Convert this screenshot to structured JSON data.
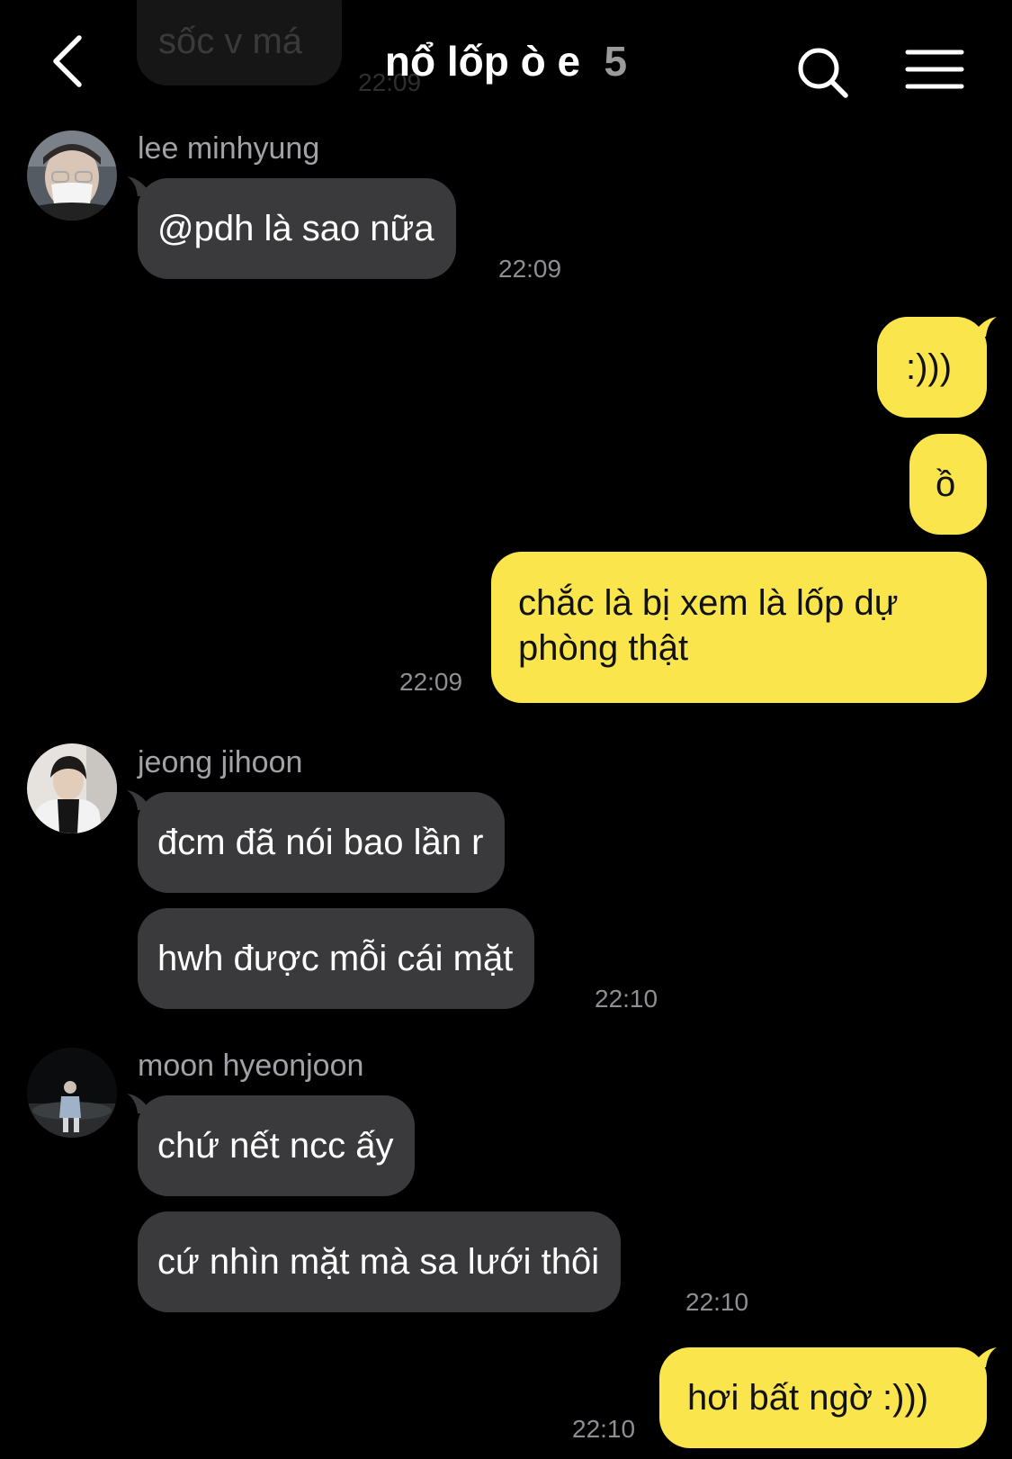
{
  "header": {
    "title": "nổ lốp ò e",
    "member_count": "5",
    "back_icon": "chevron-left-icon",
    "search_icon": "search-icon",
    "menu_icon": "hamburger-menu-icon"
  },
  "faded_prev": {
    "text": "sốc v má",
    "time": "22:09"
  },
  "messages": [
    {
      "sender": "lee minhyung",
      "avatar": "avatar-lee-minhyung",
      "bubbles": [
        "@pdh là sao nữa"
      ],
      "time": "22:09"
    },
    {
      "own": true,
      "bubbles": [
        ":)))",
        "ồ",
        "chắc là bị xem là lốp dự\nphòng thật"
      ],
      "time": "22:09"
    },
    {
      "sender": "jeong jihoon",
      "avatar": "avatar-jeong-jihoon",
      "bubbles": [
        "đcm đã nói bao lần r",
        "hwh được mỗi cái mặt"
      ],
      "time": "22:10"
    },
    {
      "sender": "moon hyeonjoon",
      "avatar": "avatar-moon-hyeonjoon",
      "bubbles": [
        "chứ nết ncc ấy",
        "cứ nhìn mặt mà sa lưới thôi"
      ],
      "time": "22:10"
    },
    {
      "own": true,
      "bubbles": [
        "hơi bất ngờ :)))"
      ],
      "time": "22:10"
    }
  ],
  "colors": {
    "background": "#000000",
    "incoming_bubble": "#3a3a3c",
    "outgoing_bubble": "#fbe54d"
  }
}
